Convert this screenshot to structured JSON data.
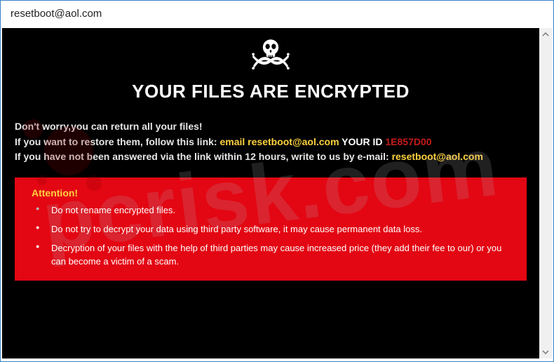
{
  "titlebar": {
    "title": "resetboot@aol.com"
  },
  "main": {
    "headline": "YOUR FILES ARE ENCRYPTED",
    "intro": {
      "line1": "Don't worry,you can return all your files!",
      "line2_prefix": "If you want to restore them, follow this link: ",
      "line2_email_label": "email ",
      "line2_email": "resetboot@aol.com",
      "line2_id_label": "   YOUR ID ",
      "line2_id": "1E857D00",
      "line3_prefix": "If you have not been answered via the link within 12 hours, write to us by e-mail: ",
      "line3_email": "resetboot@aol.com"
    },
    "attention": {
      "title": "Attention!",
      "items": [
        "Do not rename encrypted files.",
        "Do not try to decrypt your data using third party software, it may cause permanent data loss.",
        "Decryption of your files with the help of third parties may cause increased price (they add their fee to our) or you can become a victim of a scam."
      ]
    }
  },
  "watermark": {
    "text": "pcrisk.com"
  }
}
